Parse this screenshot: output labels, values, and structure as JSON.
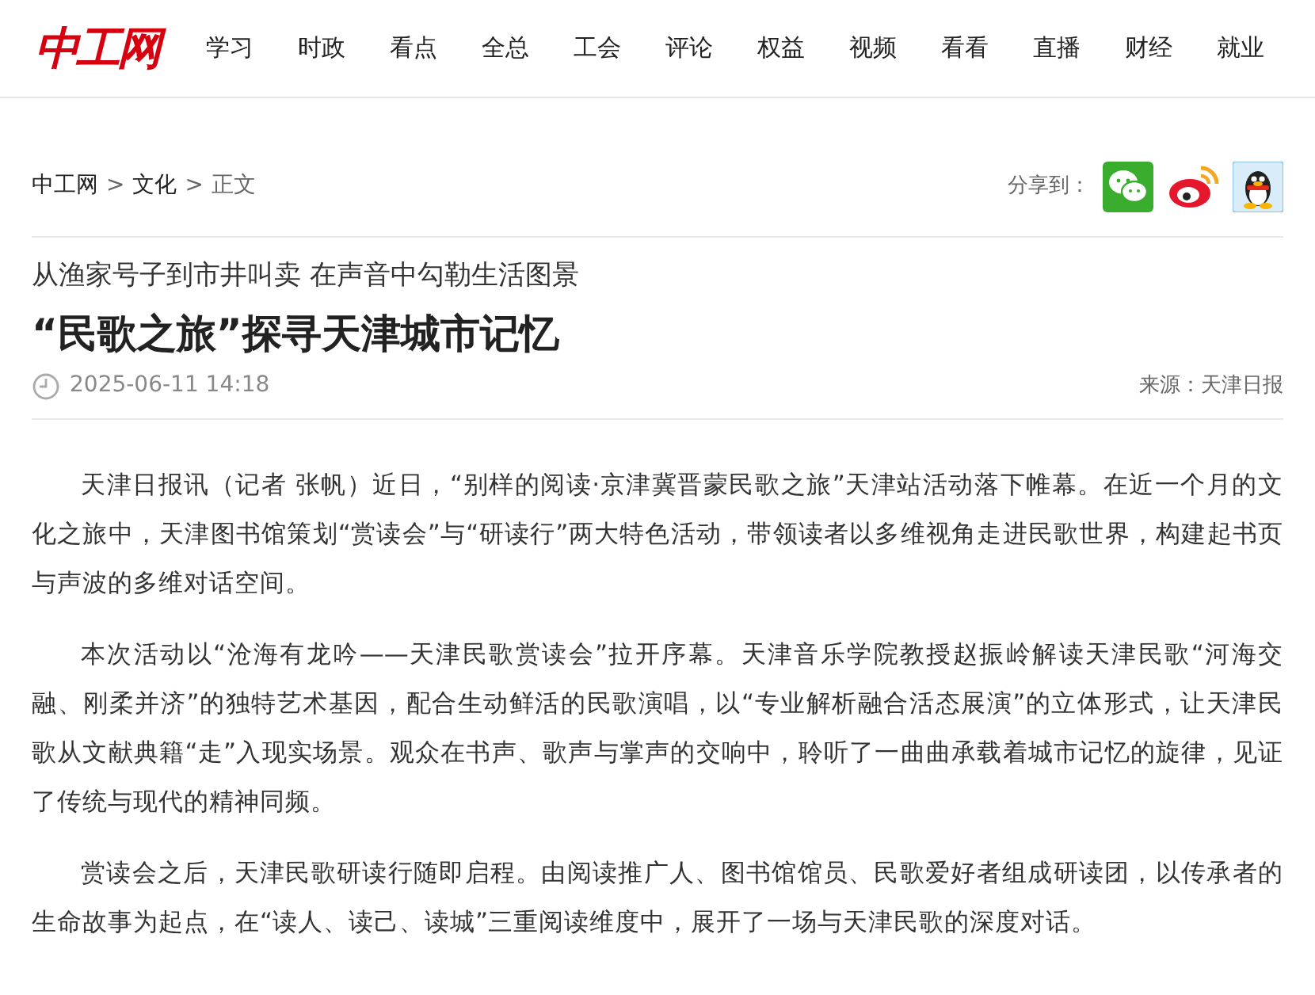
{
  "logo": "中工网",
  "nav": [
    "学习",
    "时政",
    "看点",
    "全总",
    "工会",
    "评论",
    "权益",
    "视频",
    "看看",
    "直播",
    "财经",
    "就业"
  ],
  "breadcrumb": [
    "中工网",
    "文化",
    "正文"
  ],
  "breadcrumb_separator": ">",
  "share": {
    "label": "分享到：",
    "targets": [
      {
        "kind": "wechat"
      },
      {
        "kind": "weibo"
      },
      {
        "kind": "qq"
      }
    ]
  },
  "article": {
    "subtitle": "从渔家号子到市井叫卖 在声音中勾勒生活图景",
    "title": "“民歌之旅”探寻天津城市记忆",
    "date": "2025-06-11 14:18",
    "source": "来源：天津日报",
    "paragraphs": [
      "天津日报讯（记者 张帆）近日，“别样的阅读·京津冀晋蒙民歌之旅”天津站活动落下帷幕。在近一个月的文化之旅中，天津图书馆策划“赏读会”与“研读行”两大特色活动，带领读者以多维视角走进民歌世界，构建起书页与声波的多维对话空间。",
      "本次活动以“沧海有龙吟——天津民歌赏读会”拉开序幕。天津音乐学院教授赵振岭解读天津民歌“河海交融、刚柔并济”的独特艺术基因，配合生动鲜活的民歌演唱，以“专业解析融合活态展演”的立体形式，让天津民歌从文献典籍“走”入现实场景。观众在书声、歌声与掌声的交响中，聆听了一曲曲承载着城市记忆的旋律，见证了传统与现代的精神同频。",
      "赏读会之后，天津民歌研读行随即启程。由阅读推广人、图书馆馆员、民歌爱好者组成研读团，以传承者的生命故事为起点，在“读人、读己、读城”三重阅读维度中，展开了一场与天津民歌的深度对话。"
    ]
  }
}
